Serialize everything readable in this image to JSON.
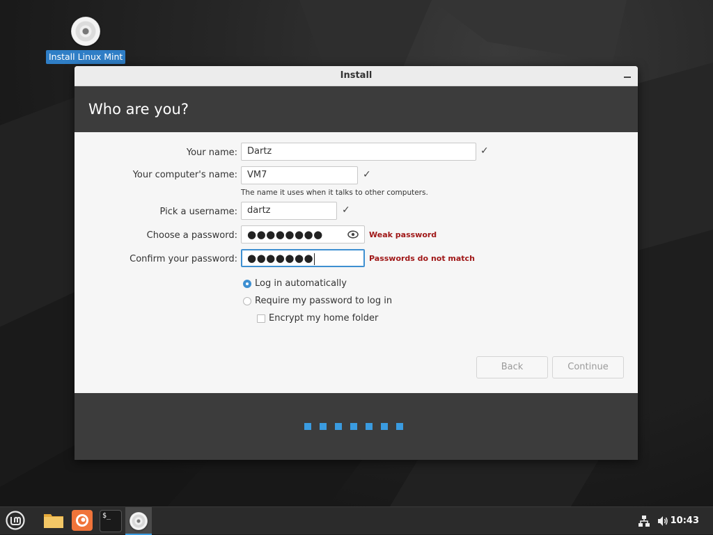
{
  "desktop": {
    "icon_label": "Install Linux Mint"
  },
  "window": {
    "title": "Install",
    "heading": "Who are you?"
  },
  "form": {
    "name_label": "Your name:",
    "name_value": "Dartz",
    "computer_label": "Your computer's name:",
    "computer_value": "VM7",
    "computer_hint": "The name it uses when it talks to other computers.",
    "username_label": "Pick a username:",
    "username_value": "dartz",
    "password_label": "Choose a password:",
    "password_value": "●●●●●●●●",
    "password_warning": "Weak password",
    "confirm_label": "Confirm your password:",
    "confirm_value": "●●●●●●●",
    "confirm_warning": "Passwords do not match",
    "login_auto_label": "Log in automatically",
    "login_password_label": "Require my password to log in",
    "encrypt_label": "Encrypt my home folder",
    "selected_login": "Log in automatically",
    "encrypt_checked": false
  },
  "buttons": {
    "back": "Back",
    "continue": "Continue"
  },
  "progress": {
    "steps": 7
  },
  "taskbar": {
    "apps": [
      "mint-menu-icon",
      "files-icon",
      "firefox-icon",
      "terminal-icon",
      "installer-disc-icon"
    ],
    "clock": "10:43"
  },
  "colors": {
    "accent": "#3a9be0",
    "header_bg": "#3c3c3c",
    "warning": "#a01818"
  }
}
